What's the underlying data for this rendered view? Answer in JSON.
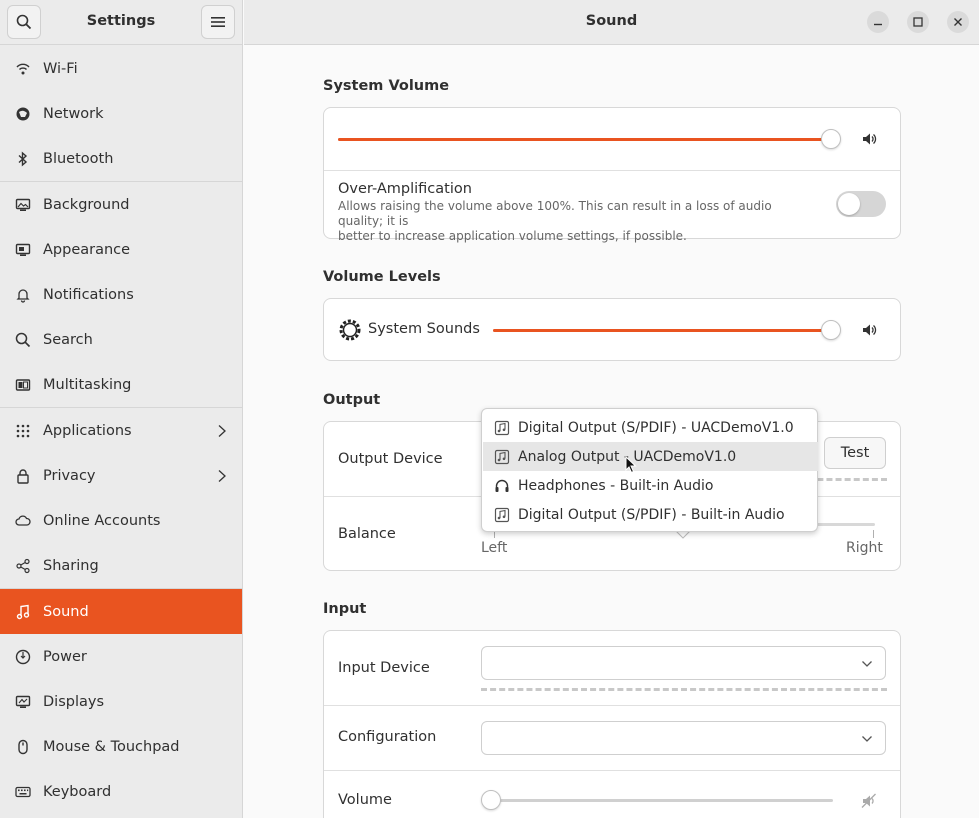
{
  "sidebar": {
    "title": "Settings",
    "items": [
      {
        "label": "Wi-Fi",
        "icon": "wifi-icon"
      },
      {
        "label": "Network",
        "icon": "network-icon"
      },
      {
        "label": "Bluetooth",
        "icon": "bluetooth-icon"
      },
      {
        "label": "Background",
        "icon": "background-icon"
      },
      {
        "label": "Appearance",
        "icon": "appearance-icon"
      },
      {
        "label": "Notifications",
        "icon": "bell-icon"
      },
      {
        "label": "Search",
        "icon": "search-icon"
      },
      {
        "label": "Multitasking",
        "icon": "multitasking-icon"
      },
      {
        "label": "Applications",
        "icon": "apps-grid-icon"
      },
      {
        "label": "Privacy",
        "icon": "lock-icon"
      },
      {
        "label": "Online Accounts",
        "icon": "cloud-icon"
      },
      {
        "label": "Sharing",
        "icon": "share-icon"
      },
      {
        "label": "Sound",
        "icon": "music-note-icon"
      },
      {
        "label": "Power",
        "icon": "power-icon"
      },
      {
        "label": "Displays",
        "icon": "display-icon"
      },
      {
        "label": "Mouse & Touchpad",
        "icon": "mouse-icon"
      },
      {
        "label": "Keyboard",
        "icon": "keyboard-icon"
      }
    ],
    "active": "Sound"
  },
  "header": {
    "title": "Sound"
  },
  "accent_color": "#e95420",
  "system_volume": {
    "section_title": "System Volume",
    "level": 1.0,
    "over_amplification": {
      "title": "Over-Amplification",
      "description_line1": "Allows raising the volume above 100%. This can result in a loss of audio quality; it is",
      "description_line2": "better to increase application volume settings, if possible.",
      "enabled": false
    }
  },
  "volume_levels": {
    "section_title": "Volume Levels",
    "system_sounds_label": "System Sounds",
    "level": 1.0
  },
  "output": {
    "section_title": "Output",
    "device_label": "Output Device",
    "test_label": "Test",
    "balance_label": "Balance",
    "balance_left": "Left",
    "balance_right": "Right",
    "device_options": [
      "Digital Output (S/PDIF) - UACDemoV1.0",
      "Analog Output - UACDemoV1.0",
      "Headphones - Built-in Audio",
      "Digital Output (S/PDIF) - Built-in Audio"
    ],
    "highlighted_option": "Analog Output - UACDemoV1.0"
  },
  "input": {
    "section_title": "Input",
    "device_label": "Input Device",
    "configuration_label": "Configuration",
    "volume_label": "Volume",
    "level": 0.0
  }
}
